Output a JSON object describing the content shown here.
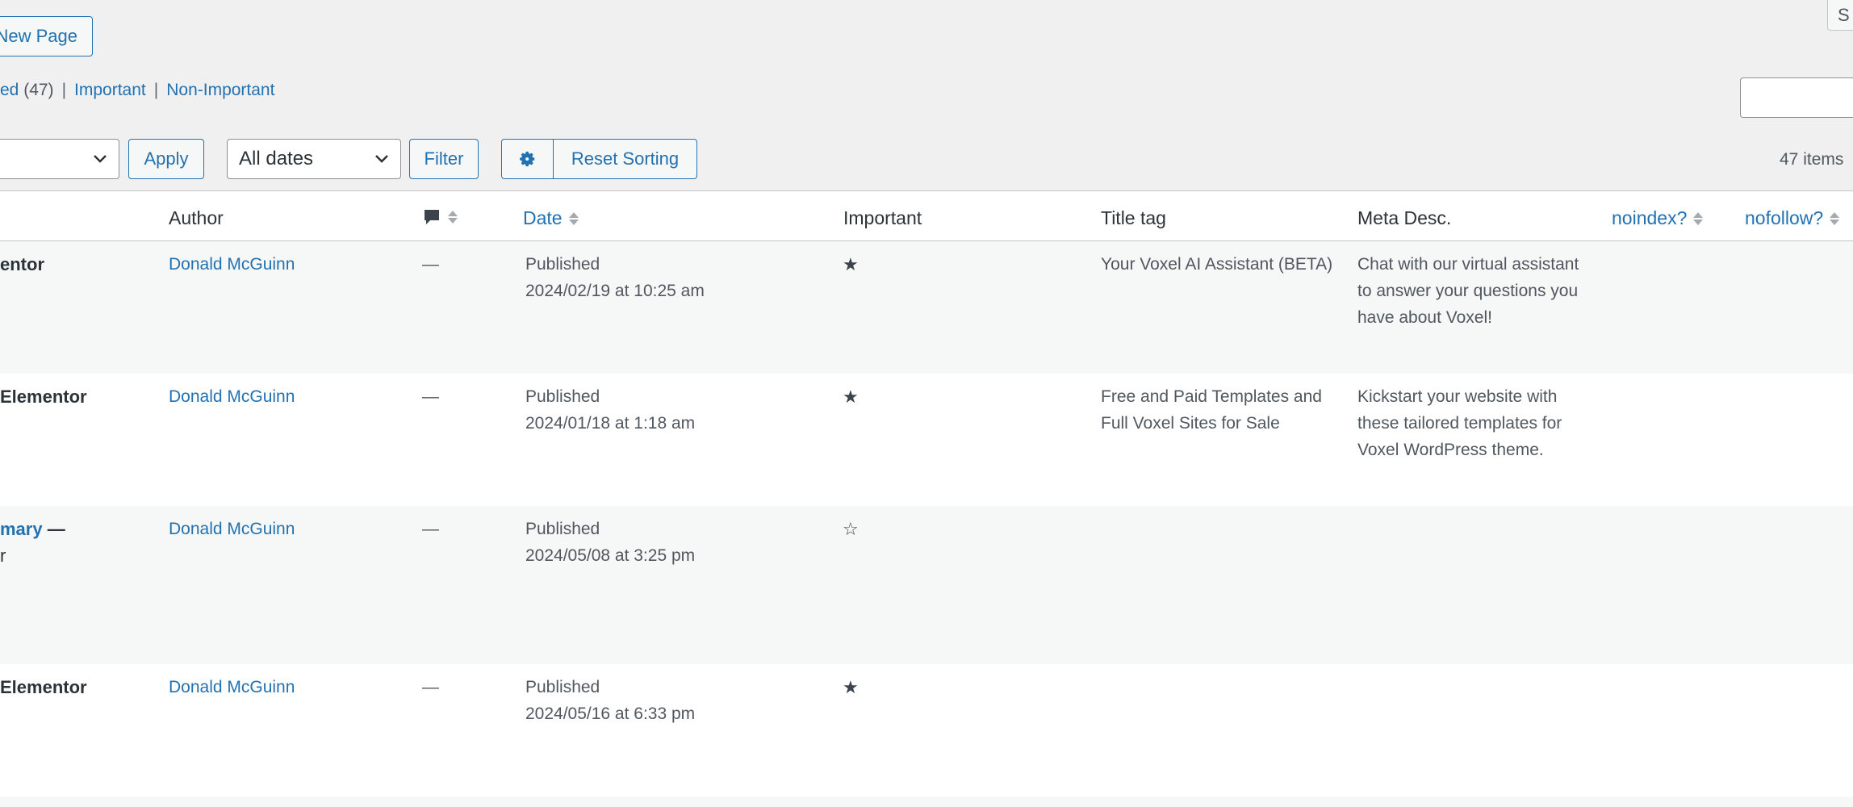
{
  "header": {
    "add_new_label": "New Page",
    "top_right_button_label": "S"
  },
  "views": {
    "current_label": "ed",
    "current_count": "(47)",
    "important_label": "Important",
    "non_important_label": "Non-Important",
    "separator": "|"
  },
  "search": {
    "placeholder": ""
  },
  "filters": {
    "bulk_action_value": "",
    "apply_label": "Apply",
    "dates_value": "All dates",
    "filter_label": "Filter",
    "reset_sorting_label": "Reset Sorting",
    "items_count": "47 items"
  },
  "table": {
    "columns": {
      "author": "Author",
      "date": "Date",
      "important": "Important",
      "title_tag": "Title tag",
      "meta_desc": "Meta Desc.",
      "noindex": "noindex?",
      "nofollow": "nofollow?"
    },
    "rows": [
      {
        "title": "entor",
        "title_suffix": "",
        "title_line2": "",
        "author": "Donald McGuinn",
        "comments": "—",
        "status": "Published",
        "date": "2024/02/19 at 10:25 am",
        "important_star": "★",
        "title_tag": "Your Voxel AI Assistant (BETA)",
        "meta_desc": "Chat with our virtual assistant to answer your questions you have about Voxel!"
      },
      {
        "title": "Elementor",
        "title_suffix": "",
        "title_line2": "",
        "author": "Donald McGuinn",
        "comments": "—",
        "status": "Published",
        "date": "2024/01/18 at 1:18 am",
        "important_star": "★",
        "title_tag": "Free and Paid Templates and Full Voxel Sites for Sale",
        "meta_desc": "Kickstart your website with these tailored templates for Voxel WordPress theme."
      },
      {
        "title": "mary",
        "title_suffix": " —",
        "title_line2": "r",
        "author": "Donald McGuinn",
        "comments": "—",
        "status": "Published",
        "date": "2024/05/08 at 3:25 pm",
        "important_star": "☆",
        "title_tag": "",
        "meta_desc": ""
      },
      {
        "title": "Elementor",
        "title_suffix": "",
        "title_line2": "",
        "author": "Donald McGuinn",
        "comments": "—",
        "status": "Published",
        "date": "2024/05/16 at 6:33 pm",
        "important_star": "★",
        "title_tag": "",
        "meta_desc": ""
      }
    ]
  },
  "icons": {
    "comment": "comment-bubble-icon",
    "gear": "gear-icon",
    "chevron": "chevron-down-icon",
    "sort": "sort-arrows-icon"
  },
  "colors": {
    "accent": "#2271b1",
    "background": "#f0f0f1",
    "row_alt": "#f6f7f7",
    "border": "#c3c4c7"
  }
}
